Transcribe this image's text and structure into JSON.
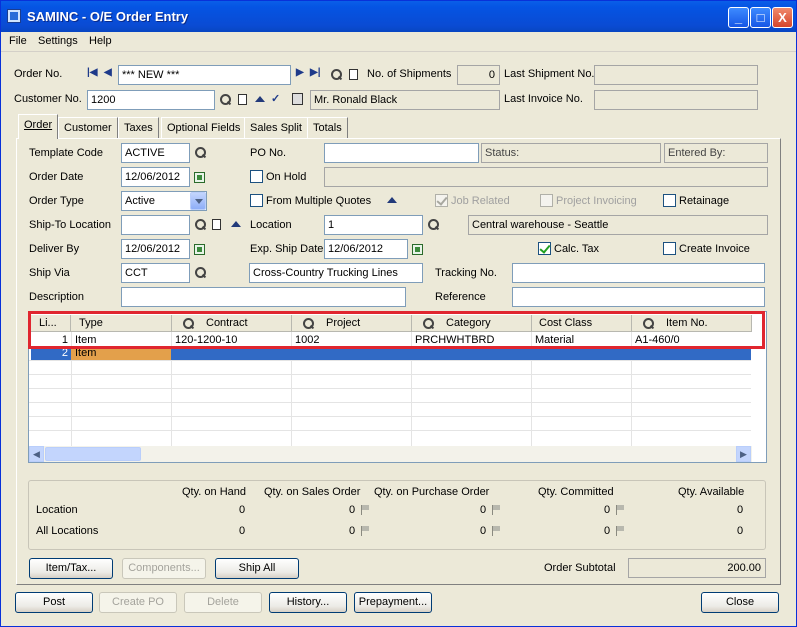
{
  "window": {
    "title": "SAMINC - O/E Order Entry",
    "minimize": "_",
    "maximize": "□",
    "close": "X"
  },
  "menu": [
    "File",
    "Settings",
    "Help"
  ],
  "header": {
    "order_no_label": "Order No.",
    "order_no_value": "*** NEW ***",
    "shipments_label": "No. of Shipments",
    "shipments_value": "0",
    "last_shipment_label": "Last Shipment No.",
    "last_shipment_value": "",
    "customer_no_label": "Customer No.",
    "customer_no_value": "1200",
    "customer_name": "Mr. Ronald Black",
    "last_invoice_label": "Last Invoice No.",
    "last_invoice_value": ""
  },
  "tabs": [
    "Order",
    "Customer",
    "Taxes",
    "Optional Fields",
    "Sales Split",
    "Totals"
  ],
  "order": {
    "template_code_label": "Template Code",
    "template_code": "ACTIVE",
    "po_label": "PO No.",
    "po_value": "",
    "status_label": "Status:",
    "entered_by_label": "Entered By:",
    "order_date_label": "Order Date",
    "order_date": "12/06/2012",
    "on_hold_label": "On Hold",
    "order_type_label": "Order Type",
    "order_type": "Active",
    "multi_quotes_label": "From Multiple Quotes",
    "job_related_label": "Job Related",
    "project_invoicing_label": "Project Invoicing",
    "retainage_label": "Retainage",
    "ship_to_label": "Ship-To Location",
    "ship_to": "",
    "location_label": "Location",
    "location": "1",
    "location_desc": "Central warehouse - Seattle",
    "deliver_by_label": "Deliver By",
    "deliver_by": "12/06/2012",
    "exp_ship_label": "Exp. Ship Date",
    "exp_ship": "12/06/2012",
    "calc_tax_label": "Calc. Tax",
    "create_invoice_label": "Create Invoice",
    "ship_via_label": "Ship Via",
    "ship_via": "CCT",
    "ship_via_desc": "Cross-Country Trucking Lines",
    "tracking_label": "Tracking No.",
    "tracking": "",
    "description_label": "Description",
    "description": "",
    "reference_label": "Reference",
    "reference": ""
  },
  "grid": {
    "columns": [
      "Li...",
      "Type",
      "Contract",
      "Project",
      "Category",
      "Cost Class",
      "Item No."
    ],
    "rows": [
      {
        "line": "1",
        "type": "Item",
        "contract": "120-1200-10",
        "project": "1002",
        "category": "PRCHWHTBRD",
        "cost_class": "Material",
        "item_no": "A1-460/0"
      },
      {
        "line": "2",
        "type": "Item",
        "contract": "",
        "project": "",
        "category": "",
        "cost_class": "",
        "item_no": ""
      }
    ]
  },
  "totals": {
    "headers": [
      "Qty. on Hand",
      "Qty. on Sales Order",
      "Qty. on Purchase Order",
      "Qty. Committed",
      "Qty. Available"
    ],
    "location_label": "Location",
    "location_values": [
      "0",
      "0",
      "0",
      "0",
      "0"
    ],
    "all_label": "All Locations",
    "all_values": [
      "0",
      "0",
      "0",
      "0",
      "0"
    ]
  },
  "buttons": {
    "item_tax": "Item/Tax...",
    "components": "Components...",
    "ship_all": "Ship All",
    "post": "Post",
    "create_po": "Create PO",
    "delete": "Delete",
    "history": "History...",
    "prepayment": "Prepayment...",
    "close": "Close"
  },
  "subtotal": {
    "label": "Order Subtotal",
    "value": "200.00"
  }
}
